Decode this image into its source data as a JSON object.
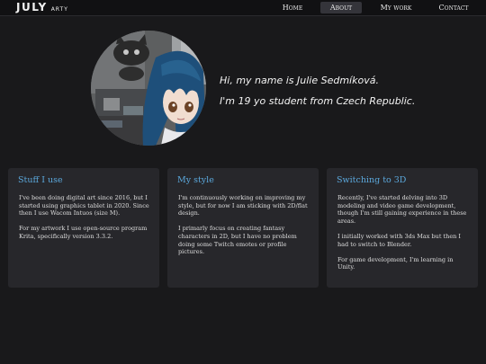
{
  "nav": {
    "logo": "JULY",
    "logo_sub": "ARTY",
    "items": [
      {
        "label": "Home",
        "active": false
      },
      {
        "label": "About",
        "active": true
      },
      {
        "label": "My work",
        "active": false
      },
      {
        "label": "Contact",
        "active": false
      }
    ]
  },
  "intro": {
    "line1": "Hi, my name is Julie Sedmíková.",
    "line2": "I'm 19 yo student from Czech Republic."
  },
  "cards": [
    {
      "title": "Stuff I use",
      "paragraphs": [
        "I've been doing digital art since 2016, but I started using graphics tablet in 2020. Since then I use Wacom Intuos (size M).",
        "For my artwork I use open-source program Krita, specifically version 3.3.2."
      ]
    },
    {
      "title": "My style",
      "paragraphs": [
        "I'm continuously working on improving my style, but for now I am sticking with 2D/flat design.",
        "I primarly focus on creating fantasy characters in 2D, but I have no problem doing some Twitch emotes or profile pictures."
      ]
    },
    {
      "title": "Switching to 3D",
      "paragraphs": [
        "Recently, I've started delving into 3D modeling and video game development, though I'm still gaining experience in these areas.",
        "I initially worked with 3ds Max but then I had to switch to Blender.",
        "For game development, I'm learning in Unity."
      ]
    }
  ],
  "colors": {
    "background": "#19191b",
    "navbar": "#111113",
    "card": "#27272b",
    "accent": "#5ba8dc",
    "active_tab": "#34343a"
  }
}
